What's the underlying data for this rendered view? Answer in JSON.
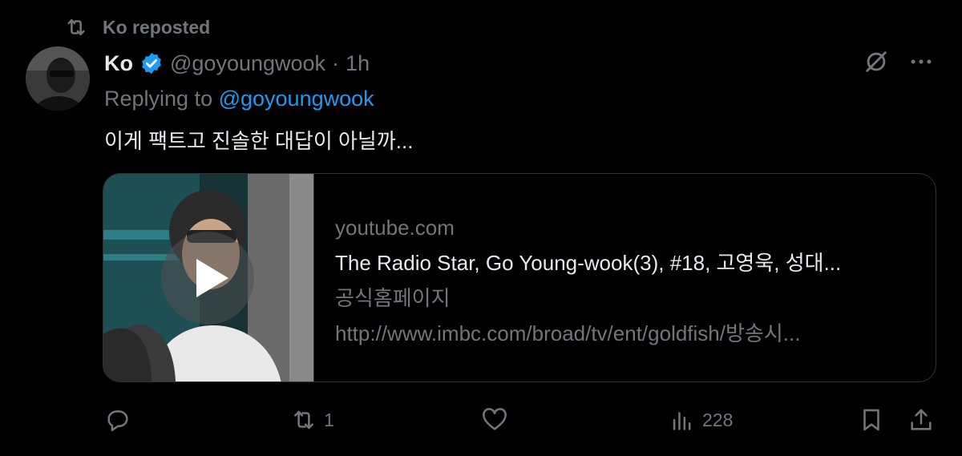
{
  "repost": {
    "label": "Ko reposted",
    "icon": "repost-icon"
  },
  "author": {
    "display_name": "Ko",
    "handle": "@goyoungwook",
    "separator": "·",
    "time": "1h",
    "verified_icon": "verified-badge-icon"
  },
  "reply": {
    "prefix": "Replying to ",
    "mention": "@goyoungwook"
  },
  "text": "이게 팩트고 진솔한 대답이 아닐까...",
  "card": {
    "domain": "youtube.com",
    "title": "The Radio Star, Go Young-wook(3), #18, 고영욱, 성대...",
    "description": "공식홈페이지",
    "url": "http://www.imbc.com/broad/tv/ent/goldfish/방송시...",
    "play_icon": "play-icon"
  },
  "actions": {
    "reply": {
      "icon": "reply-icon",
      "count": ""
    },
    "repost": {
      "icon": "repost-icon",
      "count": "1"
    },
    "like": {
      "icon": "heart-icon",
      "count": ""
    },
    "views": {
      "icon": "views-icon",
      "count": "228"
    },
    "bookmark": {
      "icon": "bookmark-icon"
    },
    "share": {
      "icon": "share-icon"
    }
  },
  "colors": {
    "background": "#000000",
    "text": "#e7e9ea",
    "muted": "#71767b",
    "accent": "#1d9bf0",
    "border": "#2f3336"
  }
}
